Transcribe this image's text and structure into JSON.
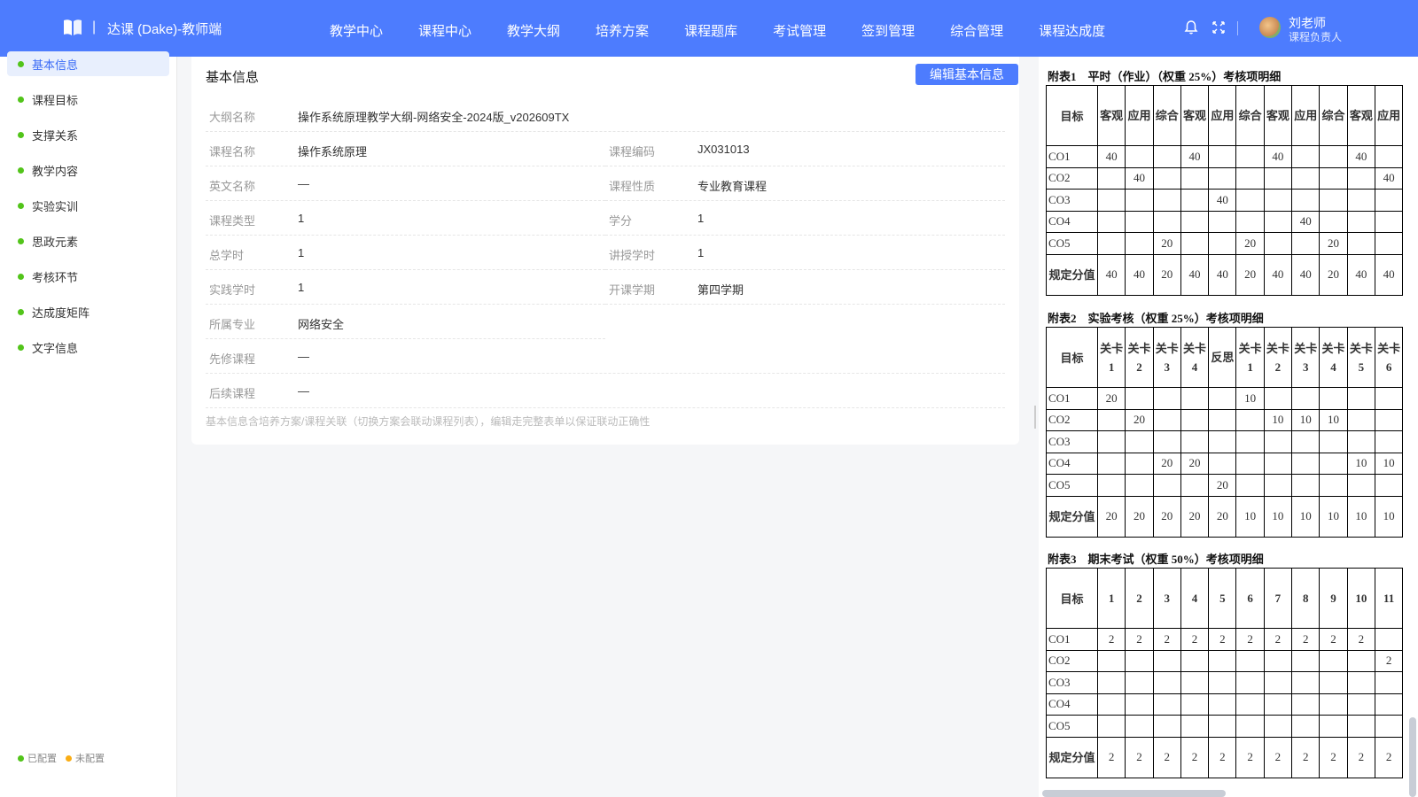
{
  "header": {
    "separator": "|",
    "brand": "达课 (Dake)-教师端",
    "nav": [
      "教学中心",
      "课程中心",
      "教学大纲",
      "培养方案",
      "课程题库",
      "考试管理",
      "签到管理",
      "综合管理",
      "课程达成度"
    ],
    "user_name": "刘老师",
    "user_role": "课程负责人",
    "colors": {
      "primary": "#4d7cfe"
    }
  },
  "sidebar": {
    "items": [
      "基本信息",
      "课程目标",
      "支撑关系",
      "教学内容",
      "实验实训",
      "思政元素",
      "考核环节",
      "达成度矩阵",
      "文字信息"
    ],
    "active": "基本信息",
    "legend": {
      "configured": "已配置",
      "unconfigured": "未配置"
    },
    "colors": {
      "configured": "#52c41a",
      "unconfigured": "#faad14"
    }
  },
  "basic": {
    "title": "基本信息",
    "edit_label": "编辑基本信息",
    "outline_name": {
      "label": "大纲名称",
      "value": "操作系统原理教学大纲-网络安全-2024版_v202609TX"
    },
    "rows": [
      {
        "l1": "课程名称",
        "v1": "操作系统原理",
        "l2": "课程编码",
        "v2": "JX031013"
      },
      {
        "l1": "英文名称",
        "v1": "—",
        "l2": "课程性质",
        "v2": "专业教育课程"
      },
      {
        "l1": "课程类型",
        "v1": "1",
        "l2": "学分",
        "v2": "1"
      },
      {
        "l1": "总学时",
        "v1": "1",
        "l2": "讲授学时",
        "v2": "1"
      },
      {
        "l1": "实践学时",
        "v1": "1",
        "l2": "开课学期",
        "v2": "第四学期"
      },
      {
        "l1": "所属专业",
        "v1": "网络安全"
      },
      {
        "l1": "先修课程",
        "v1": "—"
      },
      {
        "l1": "后续课程",
        "v1": "—"
      }
    ],
    "note": "基本信息含培养方案/课程关联（切换方案会联动课程列表），编辑走完整表单以保证联动正确性"
  },
  "attachments": [
    {
      "caption": "附表1　平时（作业）（权重 25%）考核项明细",
      "target_label": "目标",
      "columns": [
        "客观",
        "应用",
        "综合",
        "客观",
        "应用",
        "综合",
        "客观",
        "应用",
        "综合",
        "客观",
        "应用"
      ],
      "rows": [
        {
          "name": "CO1",
          "cells": [
            "40",
            "",
            "",
            "40",
            "",
            "",
            "40",
            "",
            "",
            "40",
            ""
          ]
        },
        {
          "name": "CO2",
          "cells": [
            "",
            "40",
            "",
            "",
            "",
            "",
            "",
            "",
            "",
            "",
            "40"
          ]
        },
        {
          "name": "CO3",
          "cells": [
            "",
            "",
            "",
            "",
            "40",
            "",
            "",
            "",
            "",
            "",
            ""
          ]
        },
        {
          "name": "CO4",
          "cells": [
            "",
            "",
            "",
            "",
            "",
            "",
            "",
            "40",
            "",
            "",
            ""
          ]
        },
        {
          "name": "CO5",
          "cells": [
            "",
            "",
            "20",
            "",
            "",
            "20",
            "",
            "",
            "20",
            "",
            ""
          ]
        }
      ],
      "score_label": "规定分值",
      "scores": [
        "40",
        "40",
        "20",
        "40",
        "40",
        "20",
        "40",
        "40",
        "20",
        "40",
        "40"
      ]
    },
    {
      "caption": "附表2　实验考核（权重 25%）考核项明细",
      "target_label": "目标",
      "columns": [
        "关卡1",
        "关卡2",
        "关卡3",
        "关卡4",
        "反思",
        "关卡1",
        "关卡2",
        "关卡3",
        "关卡4",
        "关卡5",
        "关卡6"
      ],
      "rows": [
        {
          "name": "CO1",
          "cells": [
            "20",
            "",
            "",
            "",
            "",
            "10",
            "",
            "",
            "",
            "",
            ""
          ]
        },
        {
          "name": "CO2",
          "cells": [
            "",
            "20",
            "",
            "",
            "",
            "",
            "10",
            "10",
            "10",
            "",
            ""
          ]
        },
        {
          "name": "CO3",
          "cells": [
            "",
            "",
            "",
            "",
            "",
            "",
            "",
            "",
            "",
            "",
            ""
          ]
        },
        {
          "name": "CO4",
          "cells": [
            "",
            "",
            "20",
            "20",
            "",
            "",
            "",
            "",
            "",
            "10",
            "10"
          ]
        },
        {
          "name": "CO5",
          "cells": [
            "",
            "",
            "",
            "",
            "20",
            "",
            "",
            "",
            "",
            "",
            ""
          ]
        }
      ],
      "score_label": "规定分值",
      "scores": [
        "20",
        "20",
        "20",
        "20",
        "20",
        "10",
        "10",
        "10",
        "10",
        "10",
        "10"
      ]
    },
    {
      "caption": "附表3　期末考试（权重 50%）考核项明细",
      "target_label": "目标",
      "columns": [
        "1",
        "2",
        "3",
        "4",
        "5",
        "6",
        "7",
        "8",
        "9",
        "10",
        "11"
      ],
      "rows": [
        {
          "name": "CO1",
          "cells": [
            "2",
            "2",
            "2",
            "2",
            "2",
            "2",
            "2",
            "2",
            "2",
            "2",
            ""
          ]
        },
        {
          "name": "CO2",
          "cells": [
            "",
            "",
            "",
            "",
            "",
            "",
            "",
            "",
            "",
            "",
            "2"
          ]
        },
        {
          "name": "CO3",
          "cells": [
            "",
            "",
            "",
            "",
            "",
            "",
            "",
            "",
            "",
            "",
            ""
          ]
        },
        {
          "name": "CO4",
          "cells": [
            "",
            "",
            "",
            "",
            "",
            "",
            "",
            "",
            "",
            "",
            ""
          ]
        },
        {
          "name": "CO5",
          "cells": [
            "",
            "",
            "",
            "",
            "",
            "",
            "",
            "",
            "",
            "",
            ""
          ]
        }
      ],
      "score_label": "规定分值",
      "scores": [
        "2",
        "2",
        "2",
        "2",
        "2",
        "2",
        "2",
        "2",
        "2",
        "2",
        "2"
      ]
    }
  ]
}
